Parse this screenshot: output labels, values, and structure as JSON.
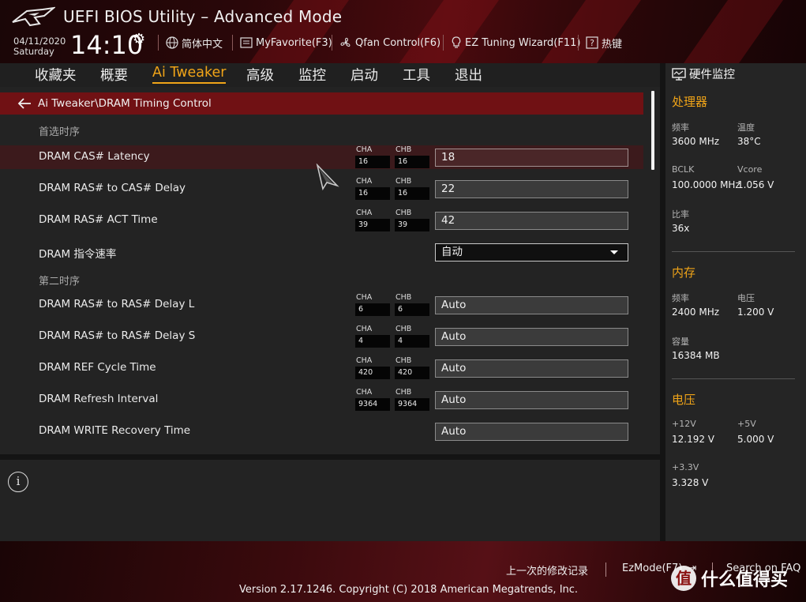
{
  "header": {
    "title": "UEFI BIOS Utility – Advanced Mode",
    "date": "04/11/2020",
    "day": "Saturday",
    "time": "14:10",
    "items": [
      {
        "label": "简体中文",
        "icon": "globe-icon"
      },
      {
        "label": "MyFavorite(F3)",
        "icon": "favorite-icon"
      },
      {
        "label": "Qfan Control(F6)",
        "icon": "fan-icon"
      },
      {
        "label": "EZ Tuning Wizard(F11)",
        "icon": "bulb-icon"
      },
      {
        "label": "热键",
        "icon": "question-icon"
      }
    ]
  },
  "tabs": [
    {
      "label": "收藏夹"
    },
    {
      "label": "概要"
    },
    {
      "label": "Ai Tweaker",
      "active": true
    },
    {
      "label": "高级"
    },
    {
      "label": "监控"
    },
    {
      "label": "启动"
    },
    {
      "label": "工具"
    },
    {
      "label": "退出"
    }
  ],
  "breadcrumb": "Ai Tweaker\\DRAM Timing Control",
  "sections": {
    "primary": "首选时序",
    "secondary": "第二时序"
  },
  "rows": [
    {
      "label": "DRAM CAS# Latency",
      "cha": "16",
      "chb": "16",
      "value": "18"
    },
    {
      "label": "DRAM RAS# to CAS# Delay",
      "cha": "16",
      "chb": "16",
      "value": "22"
    },
    {
      "label": "DRAM RAS# ACT Time",
      "cha": "39",
      "chb": "39",
      "value": "42"
    },
    {
      "label": "DRAM 指令速率",
      "value": "自动"
    },
    {
      "label": "DRAM RAS# to RAS# Delay L",
      "cha": "6",
      "chb": "6",
      "value": "Auto"
    },
    {
      "label": "DRAM RAS# to RAS# Delay S",
      "cha": "4",
      "chb": "4",
      "value": "Auto"
    },
    {
      "label": "DRAM REF Cycle Time",
      "cha": "420",
      "chb": "420",
      "value": "Auto"
    },
    {
      "label": "DRAM Refresh Interval",
      "cha": "9364",
      "chb": "9364",
      "value": "Auto"
    },
    {
      "label": "DRAM WRITE Recovery Time",
      "value": "Auto"
    }
  ],
  "channel_labels": {
    "a": "CHA",
    "b": "CHB"
  },
  "info_icon": "i",
  "monitor": {
    "title": "硬件监控",
    "cpu": {
      "heading": "处理器",
      "freq_k": "频率",
      "freq_v": "3600 MHz",
      "temp_k": "温度",
      "temp_v": "38°C",
      "bclk_k": "BCLK",
      "bclk_v": "100.0000 MHz",
      "vcore_k": "Vcore",
      "vcore_v": "1.056 V",
      "ratio_k": "比率",
      "ratio_v": "36x"
    },
    "memory": {
      "heading": "内存",
      "freq_k": "频率",
      "freq_v": "2400 MHz",
      "volt_k": "电压",
      "volt_v": "1.200 V",
      "cap_k": "容量",
      "cap_v": "16384 MB"
    },
    "voltage": {
      "heading": "电压",
      "v12_k": "+12V",
      "v12_v": "12.192 V",
      "v5_k": "+5V",
      "v5_v": "5.000 V",
      "v33_k": "+3.3V",
      "v33_v": "3.328 V"
    }
  },
  "footer": {
    "last_modified": "上一次的修改记录",
    "ezmode": "EzMode(F7)",
    "search": "Search on FAQ",
    "copyright": "Version 2.17.1246. Copyright (C) 2018 American Megatrends, Inc.",
    "watermark": "什么值得买",
    "watermark_glyph": "值"
  },
  "colors": {
    "accent": "#f0a418",
    "breadcrumb": "#701114",
    "selected_row": "#3c1a1c"
  }
}
